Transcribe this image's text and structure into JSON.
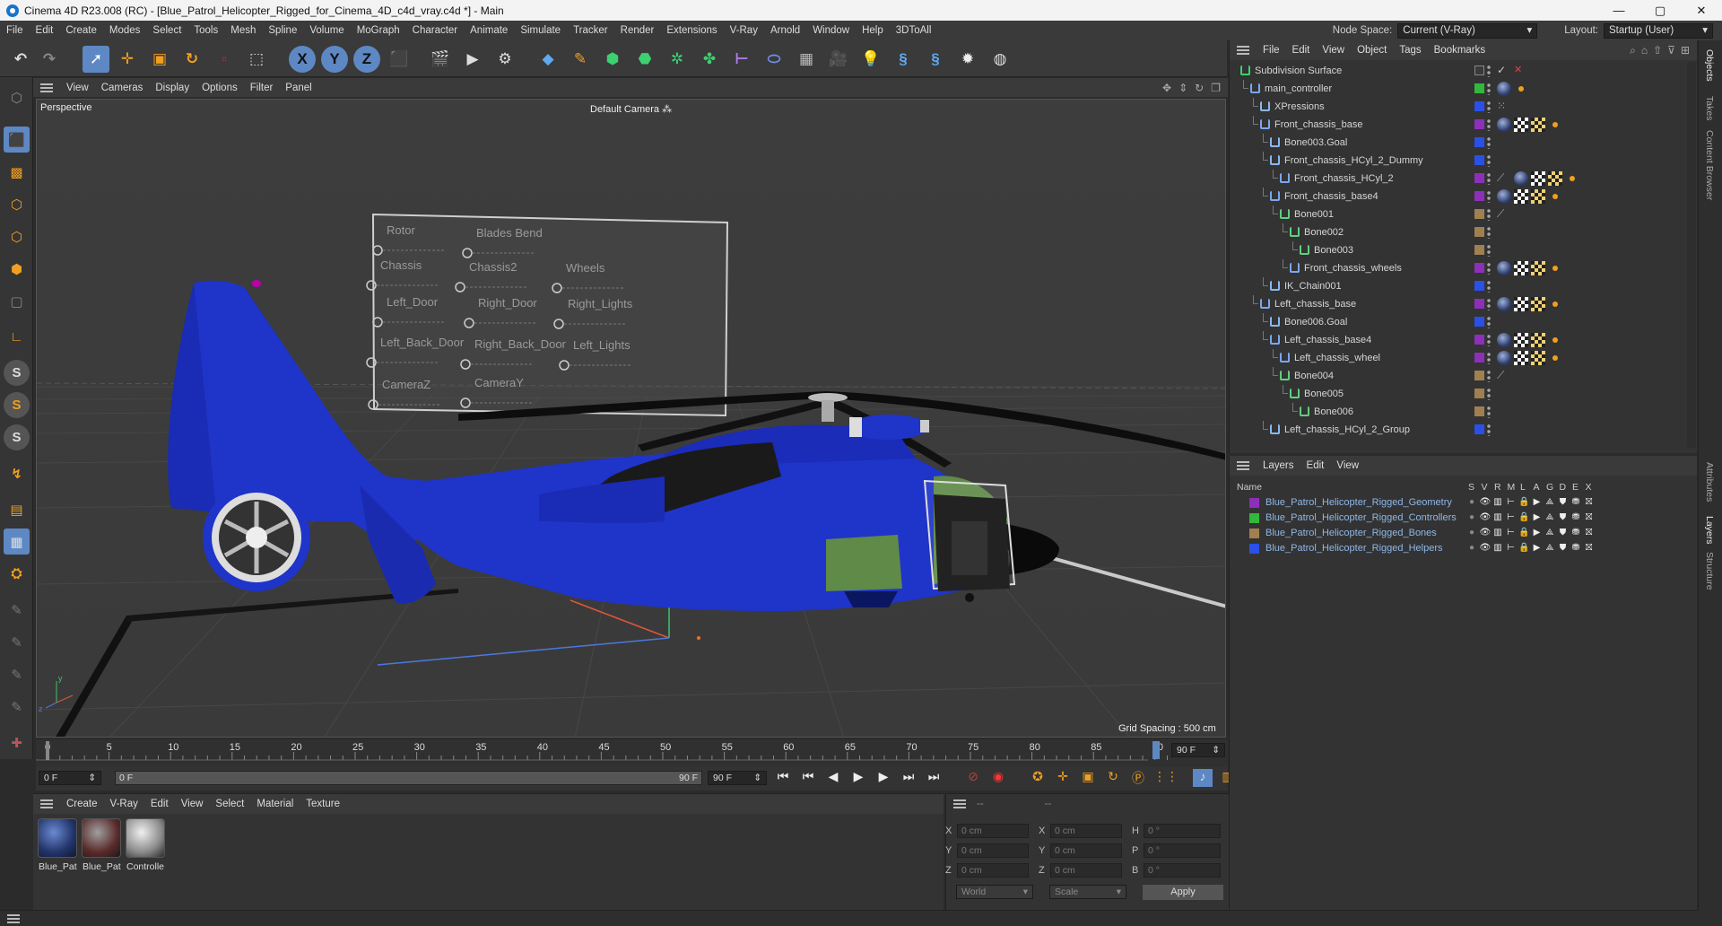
{
  "window": {
    "title": "Cinema 4D R23.008 (RC) - [Blue_Patrol_Helicopter_Rigged_for_Cinema_4D_c4d_vray.c4d *] - Main",
    "minimize": "—",
    "maximize": "▢",
    "close": "✕"
  },
  "menubar": {
    "items": [
      "File",
      "Edit",
      "Create",
      "Modes",
      "Select",
      "Tools",
      "Mesh",
      "Spline",
      "Volume",
      "MoGraph",
      "Character",
      "Animate",
      "Simulate",
      "Tracker",
      "Render",
      "Extensions",
      "V-Ray",
      "Arnold",
      "Window",
      "Help",
      "3DToAll"
    ],
    "node_space_label": "Node Space:",
    "node_space_value": "Current (V-Ray)",
    "layout_label": "Layout:",
    "layout_value": "Startup (User)"
  },
  "viewport": {
    "menu": [
      "View",
      "Cameras",
      "Display",
      "Options",
      "Filter",
      "Panel"
    ],
    "view_name": "Perspective",
    "camera": "Default Camera",
    "grid_spacing": "Grid Spacing : 500 cm",
    "rig_labels": [
      "Rotor",
      "Blades Bend",
      "Chassis",
      "Chassis2",
      "Wheels",
      "Left_Door",
      "Right_Door",
      "Right_Lights",
      "Left_Back_Door",
      "Right_Back_Door",
      "Left_Lights",
      "CameraZ",
      "CameraY"
    ]
  },
  "timeline": {
    "ticks": [
      "0",
      "5",
      "10",
      "15",
      "20",
      "25",
      "30",
      "35",
      "40",
      "45",
      "50",
      "55",
      "60",
      "65",
      "70",
      "75",
      "80",
      "85",
      "90"
    ],
    "end_field": "90 F",
    "start_field": "0 F",
    "current_field": "0 F",
    "range_end": "90 F",
    "max_field": "90 F"
  },
  "materials": {
    "menu": [
      "Create",
      "V-Ray",
      "Edit",
      "View",
      "Select",
      "Material",
      "Texture"
    ],
    "items": [
      "Blue_Pat",
      "Blue_Pat",
      "Controlle"
    ]
  },
  "coords": {
    "header": "--",
    "header2": "--",
    "x_pos": "0 cm",
    "y_pos": "0 cm",
    "z_pos": "0 cm",
    "x_size": "0 cm",
    "y_size": "0 cm",
    "z_size": "0 cm",
    "h": "0 °",
    "p": "0 °",
    "b": "0 °",
    "labels": {
      "x": "X",
      "y": "Y",
      "z": "Z",
      "x2": "X",
      "y2": "Y",
      "z2": "Z",
      "h": "H",
      "p": "P",
      "b": "B"
    },
    "world": "World",
    "scale": "Scale",
    "apply": "Apply"
  },
  "objects": {
    "menu": [
      "File",
      "Edit",
      "View",
      "Object",
      "Tags",
      "Bookmarks"
    ],
    "rows": [
      {
        "name": "Subdivision Surface",
        "depth": 0,
        "color": "#3a3a3a"
      },
      {
        "name": "main_controller",
        "depth": 1,
        "color": "#32b83a"
      },
      {
        "name": "XPressions",
        "depth": 2,
        "color": "#2a50e8"
      },
      {
        "name": "Front_chassis_base",
        "depth": 2,
        "color": "#8d2fb8"
      },
      {
        "name": "Bone003.Goal",
        "depth": 3,
        "color": "#2a50e8"
      },
      {
        "name": "Front_chassis_HCyl_2_Dummy",
        "depth": 3,
        "color": "#2a50e8"
      },
      {
        "name": "Front_chassis_HCyl_2",
        "depth": 4,
        "color": "#8d2fb8"
      },
      {
        "name": "Front_chassis_base4",
        "depth": 3,
        "color": "#8d2fb8"
      },
      {
        "name": "Bone001",
        "depth": 4,
        "color": "#a08050"
      },
      {
        "name": "Bone002",
        "depth": 5,
        "color": "#a08050"
      },
      {
        "name": "Bone003",
        "depth": 6,
        "color": "#a08050"
      },
      {
        "name": "Front_chassis_wheels",
        "depth": 5,
        "color": "#8d2fb8"
      },
      {
        "name": "IK_Chain001",
        "depth": 3,
        "color": "#2a50e8"
      },
      {
        "name": "Left_chassis_base",
        "depth": 2,
        "color": "#8d2fb8"
      },
      {
        "name": "Bone006.Goal",
        "depth": 3,
        "color": "#2a50e8"
      },
      {
        "name": "Left_chassis_base4",
        "depth": 3,
        "color": "#8d2fb8"
      },
      {
        "name": "Left_chassis_wheel",
        "depth": 4,
        "color": "#8d2fb8"
      },
      {
        "name": "Bone004",
        "depth": 4,
        "color": "#a08050"
      },
      {
        "name": "Bone005",
        "depth": 5,
        "color": "#a08050"
      },
      {
        "name": "Bone006",
        "depth": 6,
        "color": "#a08050"
      },
      {
        "name": "Left_chassis_HCyl_2_Group",
        "depth": 3,
        "color": "#2a50e8"
      }
    ]
  },
  "layers": {
    "menu": [
      "Layers",
      "Edit",
      "View"
    ],
    "col_name": "Name",
    "cols": [
      "S",
      "V",
      "R",
      "M",
      "L",
      "A",
      "G",
      "D",
      "E",
      "X"
    ],
    "rows": [
      {
        "name": "Blue_Patrol_Helicopter_Rigged_Geometry",
        "color": "#8d2fb8"
      },
      {
        "name": "Blue_Patrol_Helicopter_Rigged_Controllers",
        "color": "#32b83a"
      },
      {
        "name": "Blue_Patrol_Helicopter_Rigged_Bones",
        "color": "#a08050"
      },
      {
        "name": "Blue_Patrol_Helicopter_Rigged_Helpers",
        "color": "#2a50e8"
      }
    ]
  },
  "right_tabs": [
    "Objects",
    "Takes",
    "Content Browser",
    "Attributes",
    "Layers",
    "Structure"
  ]
}
